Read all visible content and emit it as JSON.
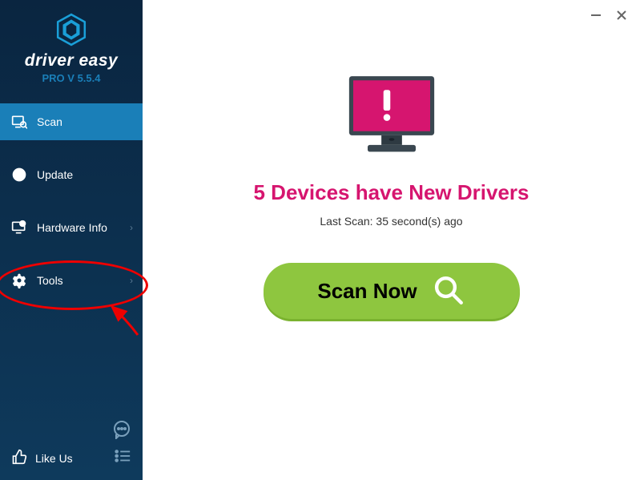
{
  "brand": {
    "name": "driver easy",
    "version": "PRO V 5.5.4"
  },
  "sidebar": {
    "items": [
      {
        "label": "Scan"
      },
      {
        "label": "Update"
      },
      {
        "label": "Hardware Info"
      },
      {
        "label": "Tools"
      }
    ],
    "like_us": "Like Us"
  },
  "main": {
    "headline": "5 Devices have New Drivers",
    "last_scan": "Last Scan: 35 second(s) ago",
    "scan_button": "Scan Now"
  },
  "colors": {
    "accent": "#1a7fb8",
    "alert": "#d6156f",
    "action": "#8ec63f"
  }
}
